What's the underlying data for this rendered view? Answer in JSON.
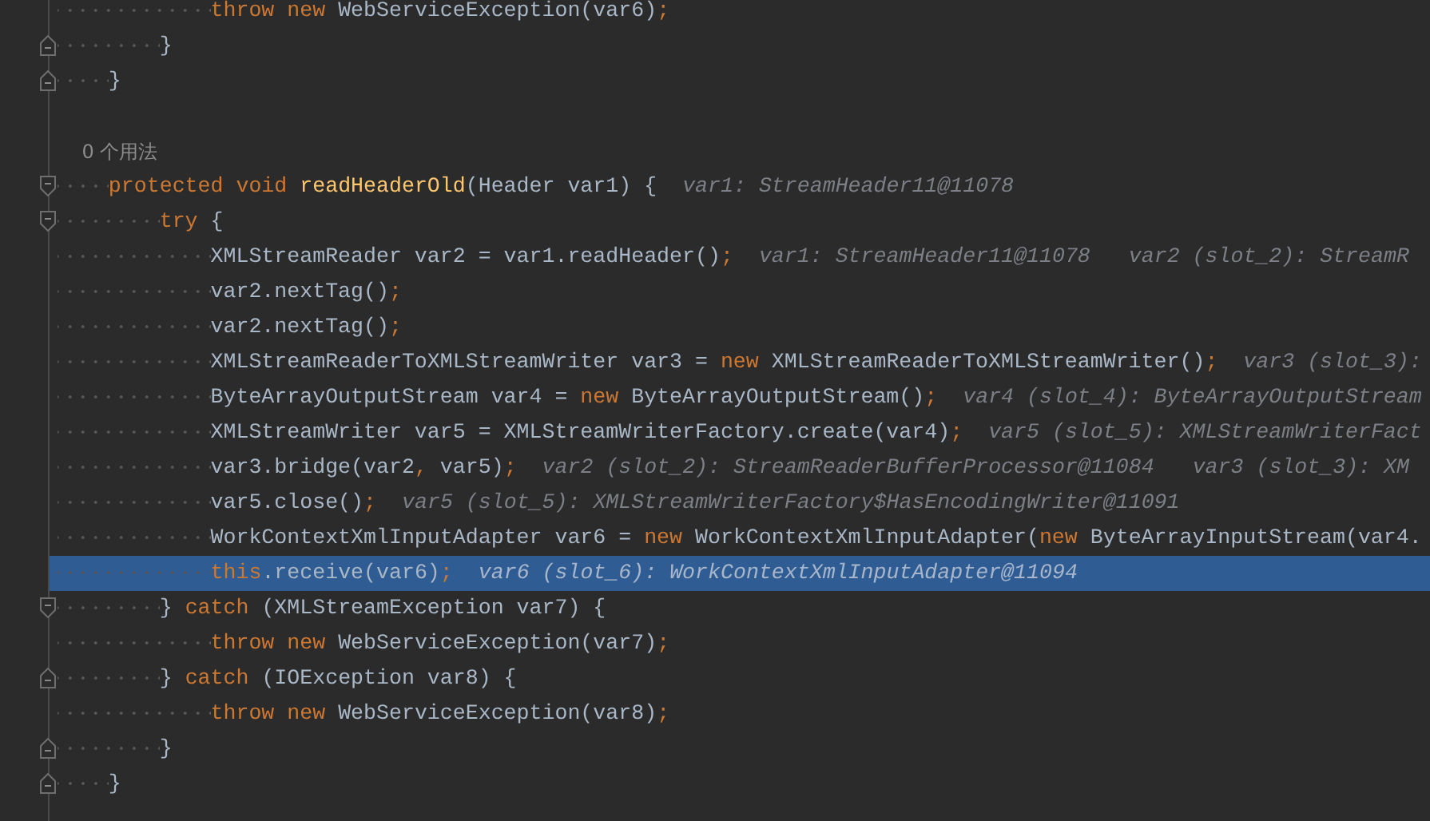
{
  "editor": {
    "lines": [
      {
        "selected": false,
        "kind": "code",
        "tokens": [
          {
            "kind": "kw",
            "text": "            throw "
          },
          {
            "kind": "kw",
            "text": "new "
          },
          {
            "kind": "plain",
            "text": "WebServiceException(var6)"
          },
          {
            "kind": "semi",
            "text": ";"
          }
        ]
      },
      {
        "selected": false,
        "kind": "code",
        "fold": {
          "kind": "end"
        },
        "tokens": [
          {
            "kind": "plain",
            "text": "        }"
          }
        ]
      },
      {
        "selected": false,
        "kind": "code",
        "fold": {
          "kind": "end"
        },
        "tokens": [
          {
            "kind": "plain",
            "text": "    }"
          }
        ]
      },
      {
        "selected": false,
        "kind": "blank"
      },
      {
        "selected": false,
        "kind": "inlay",
        "tokens": [
          {
            "kind": "usage",
            "text": "    0 个用法"
          }
        ]
      },
      {
        "selected": false,
        "kind": "code",
        "fold": {
          "kind": "start"
        },
        "tokens": [
          {
            "kind": "kw",
            "text": "    protected "
          },
          {
            "kind": "kw",
            "text": "void "
          },
          {
            "kind": "fn",
            "text": "readHeaderOld"
          },
          {
            "kind": "plain",
            "text": "(Header var1) {"
          }
        ],
        "hints": [
          "var1: StreamHeader11@11078"
        ]
      },
      {
        "selected": false,
        "kind": "code",
        "fold": {
          "kind": "start"
        },
        "tokens": [
          {
            "kind": "kw",
            "text": "        try "
          },
          {
            "kind": "plain",
            "text": "{"
          }
        ]
      },
      {
        "selected": false,
        "kind": "code",
        "tokens": [
          {
            "kind": "plain",
            "text": "            XMLStreamReader var2 = var1.readHeader()"
          },
          {
            "kind": "semi",
            "text": ";"
          }
        ],
        "hints": [
          "var1: StreamHeader11@11078",
          "var2 (slot_2): StreamR"
        ]
      },
      {
        "selected": false,
        "kind": "code",
        "tokens": [
          {
            "kind": "plain",
            "text": "            var2.nextTag()"
          },
          {
            "kind": "semi",
            "text": ";"
          }
        ]
      },
      {
        "selected": false,
        "kind": "code",
        "tokens": [
          {
            "kind": "plain",
            "text": "            var2.nextTag()"
          },
          {
            "kind": "semi",
            "text": ";"
          }
        ]
      },
      {
        "selected": false,
        "kind": "code",
        "tokens": [
          {
            "kind": "plain",
            "text": "            XMLStreamReaderToXMLStreamWriter var3 = "
          },
          {
            "kind": "kw",
            "text": "new "
          },
          {
            "kind": "plain",
            "text": "XMLStreamReaderToXMLStreamWriter()"
          },
          {
            "kind": "semi",
            "text": ";"
          }
        ],
        "hints": [
          "var3 (slot_3):"
        ]
      },
      {
        "selected": false,
        "kind": "code",
        "tokens": [
          {
            "kind": "plain",
            "text": "            ByteArrayOutputStream var4 = "
          },
          {
            "kind": "kw",
            "text": "new "
          },
          {
            "kind": "plain",
            "text": "ByteArrayOutputStream()"
          },
          {
            "kind": "semi",
            "text": ";"
          }
        ],
        "hints": [
          "var4 (slot_4): ByteArrayOutputStream"
        ]
      },
      {
        "selected": false,
        "kind": "code",
        "tokens": [
          {
            "kind": "plain",
            "text": "            XMLStreamWriter var5 = XMLStreamWriterFactory.create(var4)"
          },
          {
            "kind": "semi",
            "text": ";"
          }
        ],
        "hints": [
          "var5 (slot_5): XMLStreamWriterFact"
        ]
      },
      {
        "selected": false,
        "kind": "code",
        "tokens": [
          {
            "kind": "plain",
            "text": "            var3.bridge(var2"
          },
          {
            "kind": "semi",
            "text": ", "
          },
          {
            "kind": "plain",
            "text": "var5)"
          },
          {
            "kind": "semi",
            "text": ";"
          }
        ],
        "hints": [
          "var2 (slot_2): StreamReaderBufferProcessor@11084",
          "var3 (slot_3): XM"
        ]
      },
      {
        "selected": false,
        "kind": "code",
        "tokens": [
          {
            "kind": "plain",
            "text": "            var5.close()"
          },
          {
            "kind": "semi",
            "text": ";"
          }
        ],
        "hints": [
          "var5 (slot_5): XMLStreamWriterFactory$HasEncodingWriter@11091"
        ]
      },
      {
        "selected": false,
        "kind": "code",
        "tokens": [
          {
            "kind": "plain",
            "text": "            WorkContextXmlInputAdapter var6 = "
          },
          {
            "kind": "kw",
            "text": "new "
          },
          {
            "kind": "plain",
            "text": "WorkContextXmlInputAdapter("
          },
          {
            "kind": "kw",
            "text": "new "
          },
          {
            "kind": "plain",
            "text": "ByteArrayInputStream(var4."
          }
        ]
      },
      {
        "selected": true,
        "kind": "code",
        "tokens": [
          {
            "kind": "kw",
            "text": "            this"
          },
          {
            "kind": "plain",
            "text": ".receive(var6)"
          },
          {
            "kind": "semi",
            "text": ";"
          }
        ],
        "hints": [
          "var6 (slot_6): WorkContextXmlInputAdapter@11094"
        ]
      },
      {
        "selected": false,
        "kind": "code",
        "fold": {
          "kind": "start"
        },
        "tokens": [
          {
            "kind": "plain",
            "text": "        } "
          },
          {
            "kind": "kw",
            "text": "catch "
          },
          {
            "kind": "plain",
            "text": "(XMLStreamException var7) {"
          }
        ]
      },
      {
        "selected": false,
        "kind": "code",
        "tokens": [
          {
            "kind": "kw",
            "text": "            throw "
          },
          {
            "kind": "kw",
            "text": "new "
          },
          {
            "kind": "plain",
            "text": "WebServiceException(var7)"
          },
          {
            "kind": "semi",
            "text": ";"
          }
        ]
      },
      {
        "selected": false,
        "kind": "code",
        "fold": {
          "kind": "end"
        },
        "tokens": [
          {
            "kind": "plain",
            "text": "        } "
          },
          {
            "kind": "kw",
            "text": "catch "
          },
          {
            "kind": "plain",
            "text": "(IOException var8) {"
          }
        ]
      },
      {
        "selected": false,
        "kind": "code",
        "tokens": [
          {
            "kind": "kw",
            "text": "            throw "
          },
          {
            "kind": "kw",
            "text": "new "
          },
          {
            "kind": "plain",
            "text": "WebServiceException(var8)"
          },
          {
            "kind": "semi",
            "text": ";"
          }
        ]
      },
      {
        "selected": false,
        "kind": "code",
        "fold": {
          "kind": "end"
        },
        "tokens": [
          {
            "kind": "plain",
            "text": "        }"
          }
        ]
      },
      {
        "selected": false,
        "kind": "code",
        "fold": {
          "kind": "end"
        },
        "tokens": [
          {
            "kind": "plain",
            "text": "    }"
          }
        ]
      }
    ]
  }
}
